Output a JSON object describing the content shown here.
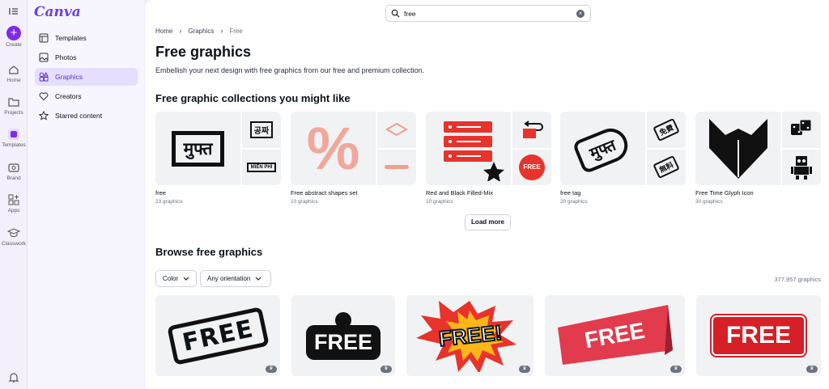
{
  "rail": {
    "create": "Create",
    "home": "Home",
    "projects": "Projects",
    "templates": "Templates",
    "brand": "Brand",
    "apps": "Apps",
    "classwork": "Classwork"
  },
  "logo": "Canva",
  "sidebar": {
    "items": [
      {
        "label": "Templates",
        "icon": "layout-icon"
      },
      {
        "label": "Photos",
        "icon": "image-icon"
      },
      {
        "label": "Graphics",
        "icon": "shapes-icon"
      },
      {
        "label": "Creators",
        "icon": "heart-icon"
      },
      {
        "label": "Starred content",
        "icon": "star-icon"
      }
    ]
  },
  "search": {
    "value": "free",
    "clear": "×"
  },
  "breadcrumb": {
    "home": "Home",
    "graphics": "Graphics",
    "current": "Free",
    "sep": "›"
  },
  "page": {
    "title": "Free graphics",
    "subtitle": "Embellish your next design with free graphics from our free and premium collection."
  },
  "collections": {
    "heading": "Free graphic collections you might like",
    "items": [
      {
        "title": "free",
        "count": "23 graphics",
        "big": "मुफ्त",
        "s1": "공짜",
        "s2": "MIỄN PHÍ"
      },
      {
        "title": "Free abstract shapes set",
        "count": "10 graphics",
        "big": "%"
      },
      {
        "title": "Red and Black Filled-Mix",
        "count": "10 graphics",
        "s2": "FREE"
      },
      {
        "title": "free tag",
        "count": "20 graphics",
        "big": "मुफ्त",
        "s1": "免費",
        "s2": "無料"
      },
      {
        "title": "Free Time Glyph Icon",
        "count": "30 graphics"
      }
    ],
    "load_more": "Load more"
  },
  "browse": {
    "heading": "Browse free graphics",
    "color_filter": "Color",
    "orientation_filter": "Any orientation",
    "total": "377,957 graphics",
    "tiles": [
      "FREE",
      "FREE",
      "FREE!",
      "FREE",
      "FREE"
    ]
  },
  "colors": {
    "brand": "#7d2ae8",
    "accent_bg": "#e5defc",
    "red": "#e8332c"
  }
}
